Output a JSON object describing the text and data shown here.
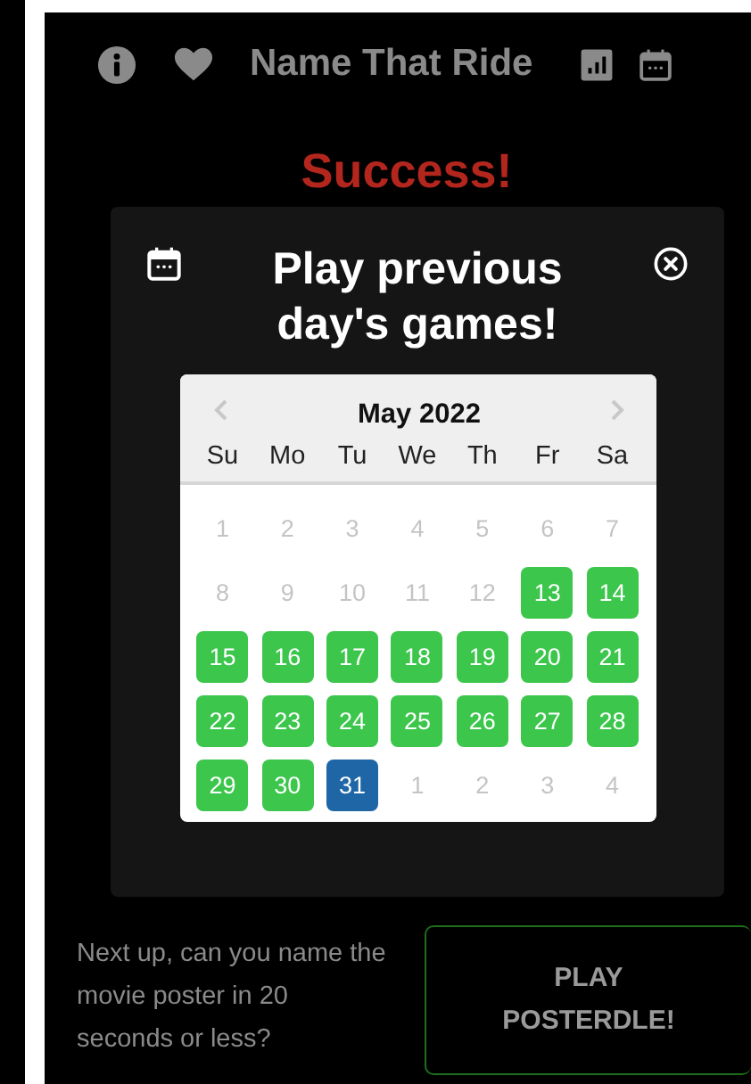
{
  "header": {
    "title": "Name That Ride"
  },
  "result": {
    "title": "Success!"
  },
  "modal": {
    "title": "Play previous day's games!",
    "calendar": {
      "month": "May 2022",
      "weekdays": [
        "Su",
        "Mo",
        "Tu",
        "We",
        "Th",
        "Fr",
        "Sa"
      ],
      "days": [
        {
          "label": "1",
          "enabled": false,
          "selected": false
        },
        {
          "label": "2",
          "enabled": false,
          "selected": false
        },
        {
          "label": "3",
          "enabled": false,
          "selected": false
        },
        {
          "label": "4",
          "enabled": false,
          "selected": false
        },
        {
          "label": "5",
          "enabled": false,
          "selected": false
        },
        {
          "label": "6",
          "enabled": false,
          "selected": false
        },
        {
          "label": "7",
          "enabled": false,
          "selected": false
        },
        {
          "label": "8",
          "enabled": false,
          "selected": false
        },
        {
          "label": "9",
          "enabled": false,
          "selected": false
        },
        {
          "label": "10",
          "enabled": false,
          "selected": false
        },
        {
          "label": "11",
          "enabled": false,
          "selected": false
        },
        {
          "label": "12",
          "enabled": false,
          "selected": false
        },
        {
          "label": "13",
          "enabled": true,
          "selected": false
        },
        {
          "label": "14",
          "enabled": true,
          "selected": false
        },
        {
          "label": "15",
          "enabled": true,
          "selected": false
        },
        {
          "label": "16",
          "enabled": true,
          "selected": false
        },
        {
          "label": "17",
          "enabled": true,
          "selected": false
        },
        {
          "label": "18",
          "enabled": true,
          "selected": false
        },
        {
          "label": "19",
          "enabled": true,
          "selected": false
        },
        {
          "label": "20",
          "enabled": true,
          "selected": false
        },
        {
          "label": "21",
          "enabled": true,
          "selected": false
        },
        {
          "label": "22",
          "enabled": true,
          "selected": false
        },
        {
          "label": "23",
          "enabled": true,
          "selected": false
        },
        {
          "label": "24",
          "enabled": true,
          "selected": false
        },
        {
          "label": "25",
          "enabled": true,
          "selected": false
        },
        {
          "label": "26",
          "enabled": true,
          "selected": false
        },
        {
          "label": "27",
          "enabled": true,
          "selected": false
        },
        {
          "label": "28",
          "enabled": true,
          "selected": false
        },
        {
          "label": "29",
          "enabled": true,
          "selected": false
        },
        {
          "label": "30",
          "enabled": true,
          "selected": false
        },
        {
          "label": "31",
          "enabled": true,
          "selected": true
        },
        {
          "label": "1",
          "enabled": false,
          "selected": false
        },
        {
          "label": "2",
          "enabled": false,
          "selected": false
        },
        {
          "label": "3",
          "enabled": false,
          "selected": false
        },
        {
          "label": "4",
          "enabled": false,
          "selected": false
        }
      ]
    }
  },
  "next_up": {
    "text": "Next up, can you name the movie poster in 20 seconds or less?",
    "button": "PLAY POSTERDLE!"
  }
}
